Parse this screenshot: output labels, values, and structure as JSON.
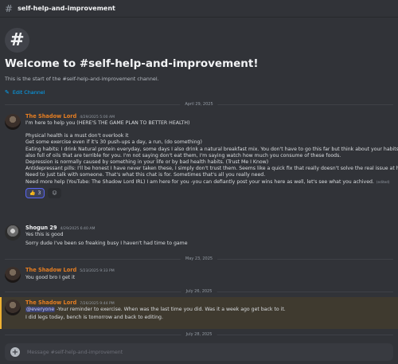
{
  "header": {
    "channel": "self-help-and-improvement"
  },
  "welcome": {
    "icon": "#",
    "title": "Welcome to #self-help-and-improvement!",
    "subtitle": "This is the start of the #self-help-and-improvement channel.",
    "edit_label": "Edit Channel"
  },
  "dividers": [
    "April 29, 2025",
    "May 23, 2025",
    "July 26, 2025",
    "July 28, 2025"
  ],
  "messages": [
    {
      "author": "The Shadow Lord",
      "author_color": "#e67e22",
      "timestamp": "4/29/2025 5:00 AM",
      "lines": [
        "I'm here to help you (HERE'S THE GAME PLAN TO BETTER HEALTH)",
        "",
        "Physical health is a must don't overlook it",
        "Get some exercise even if it's 30 push-ups a day, a run, (do something)",
        "Eating habits: I drink Natural protein everyday, some days I also drink a natural breakfast mix. You don't have to go this far but think about your habits.",
        "also full of oils that are terrible for you. I'm not saying don't eat them, I'm saying watch how much you consume of these foods.",
        "Depression is normally caused by something in your life or by bad health habits. (Trust Me I Know)",
        "Antidepressant pills: I'll be honest I have never taken these, I simply don't trust them. Seems like a quick fix that really doesn't solve the real issue at ha",
        "Need to just talk with someone. That's what this chat is for. Sometimes that's all you really need.",
        "Need more help (YouTube: The Shadow Lord IRL) I am here for you  -you can defiantly post your wins here as well, let's see what you achived."
      ],
      "edited": "(edited)",
      "reactions": [
        {
          "emoji": "👍",
          "count": "3"
        }
      ],
      "add_reaction": "☺"
    },
    {
      "author": "Shogun 29",
      "author_color": "#f2f3f5",
      "timestamp": "4/29/2025 6:40 AM",
      "lines": [
        "Yes this is good",
        "Sorry dude I've been so freaking busy I haven't had time to game"
      ]
    },
    {
      "author": "The Shadow Lord",
      "author_color": "#e67e22",
      "timestamp": "5/23/2025 9:33 PM",
      "lines": [
        "You good bro I get it"
      ]
    },
    {
      "author": "The Shadow Lord",
      "author_color": "#e67e22",
      "timestamp": "7/26/2025 9:44 PM",
      "mention": "@everyone",
      "first_line_rest": " -Your reminder to exercise. When was the last time you did. Was it a week ago get back to it.",
      "lines": [
        "I did legs today, bench is tomorrow and back to editing."
      ]
    }
  ],
  "composer": {
    "placeholder": "Message #self-help-and-improvement"
  },
  "colors": {
    "accent": "#5865f2",
    "link": "#00a8fc",
    "mention_highlight": "#f0b232"
  }
}
